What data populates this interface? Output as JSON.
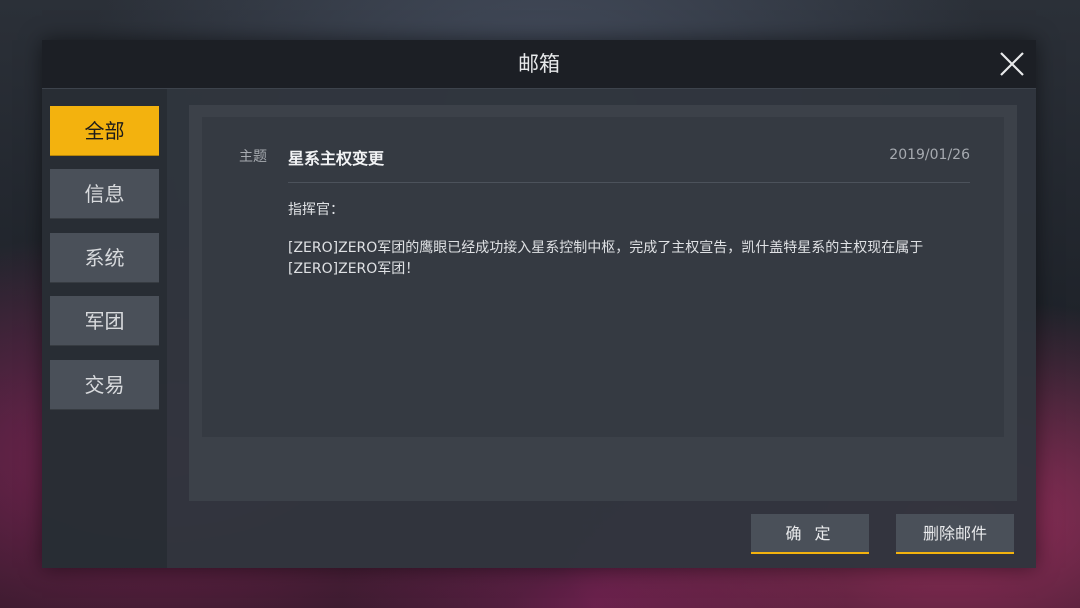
{
  "window": {
    "title": "邮箱",
    "close_icon": "close-icon"
  },
  "sidebar": {
    "items": [
      {
        "label": "全部",
        "active": true
      },
      {
        "label": "信息",
        "active": false
      },
      {
        "label": "系统",
        "active": false
      },
      {
        "label": "军团",
        "active": false
      },
      {
        "label": "交易",
        "active": false
      }
    ]
  },
  "mail": {
    "subject_label": "主题",
    "subject": "星系主权变更",
    "date": "2019/01/26",
    "greeting": "指挥官：",
    "body": "[ZERO]ZERO军团的鹰眼已经成功接入星系控制中枢，完成了主权宣告，凯什盖特星系的主权现在属于[ZERO]ZERO军团！"
  },
  "actions": {
    "confirm_label": "确 定",
    "delete_label": "删除邮件"
  },
  "colors": {
    "accent": "#f3b20e",
    "panel": "#30353d",
    "tab_inactive": "#4a5059"
  }
}
